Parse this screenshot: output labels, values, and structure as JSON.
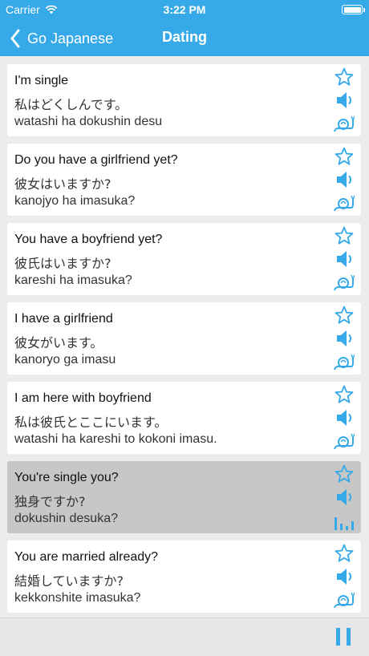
{
  "status": {
    "carrier": "Carrier",
    "time": "3:22 PM"
  },
  "nav": {
    "back_label": "Go Japanese",
    "title": "Dating"
  },
  "colors": {
    "accent": "#36a9e8",
    "card": "#ffffff",
    "active_card": "#c7c7c7",
    "background": "#ececec"
  },
  "phrases": [
    {
      "en": "I'm single",
      "jp": "私はどくしんです。",
      "romaji": "watashi ha dokushin desu",
      "playing": false
    },
    {
      "en": "Do you have a girlfriend yet?",
      "jp": "彼女はいますか?",
      "romaji": "kanojyo ha imasuka?",
      "playing": false
    },
    {
      "en": "You have a boyfriend yet?",
      "jp": "彼氏はいますか?",
      "romaji": "kareshi ha imasuka?",
      "playing": false
    },
    {
      "en": "I have a girlfriend",
      "jp": "彼女がいます。",
      "romaji": "kanoryo ga imasu",
      "playing": false
    },
    {
      "en": "I am here with boyfriend",
      "jp": "私は彼氏とここにいます。",
      "romaji": "watashi ha kareshi to kokoni imasu.",
      "playing": false
    },
    {
      "en": "You're single you?",
      "jp": "独身ですか?",
      "romaji": "dokushin desuka?",
      "playing": true
    },
    {
      "en": "You are married already?",
      "jp": "結婚していますか?",
      "romaji": "kekkonshite imasuka?",
      "playing": false
    }
  ],
  "icons": {
    "favorite": "star-outline-icon",
    "audio": "speaker-icon",
    "slow_audio": "snail-icon",
    "playing": "equalizer-icon",
    "player": "pause-icon"
  }
}
